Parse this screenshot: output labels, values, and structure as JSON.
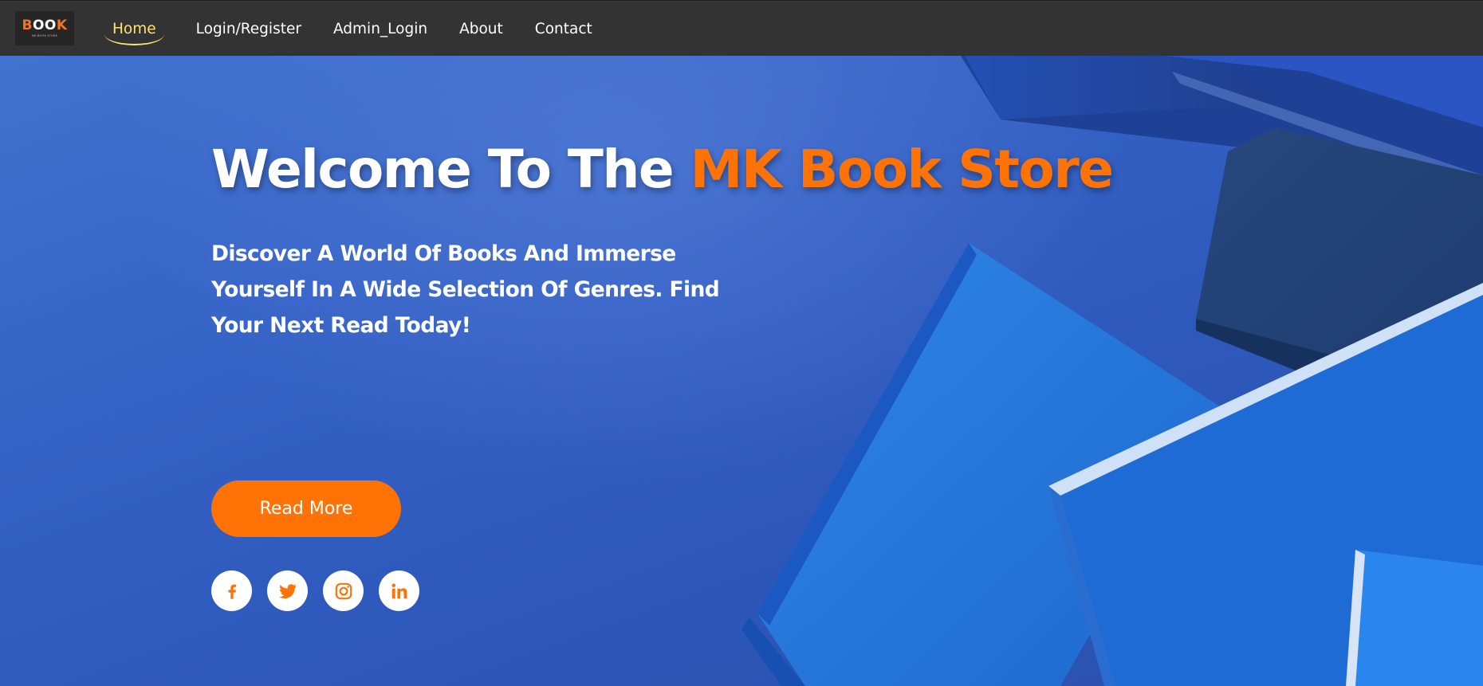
{
  "brand": {
    "logo_text": "BOOK",
    "logo_tagline": "MK BOOK STORE",
    "accent_color": "#ff7306",
    "active_nav_color": "#ffe36e"
  },
  "nav": {
    "items": [
      {
        "label": "Home",
        "active": true
      },
      {
        "label": "Login/Register",
        "active": false
      },
      {
        "label": "Admin_Login",
        "active": false
      },
      {
        "label": "About",
        "active": false
      },
      {
        "label": "Contact",
        "active": false
      }
    ]
  },
  "hero": {
    "title_prefix": "Welcome To The ",
    "title_accent": "MK Book Store",
    "subtitle": "Discover A World Of Books And Immerse Yourself In A Wide Selection Of Genres. Find Your Next Read Today!",
    "cta_label": "Read More"
  },
  "social": [
    {
      "name": "facebook",
      "icon": "facebook-icon"
    },
    {
      "name": "twitter",
      "icon": "twitter-icon"
    },
    {
      "name": "instagram",
      "icon": "instagram-icon"
    },
    {
      "name": "linkedin",
      "icon": "linkedin-icon"
    }
  ]
}
